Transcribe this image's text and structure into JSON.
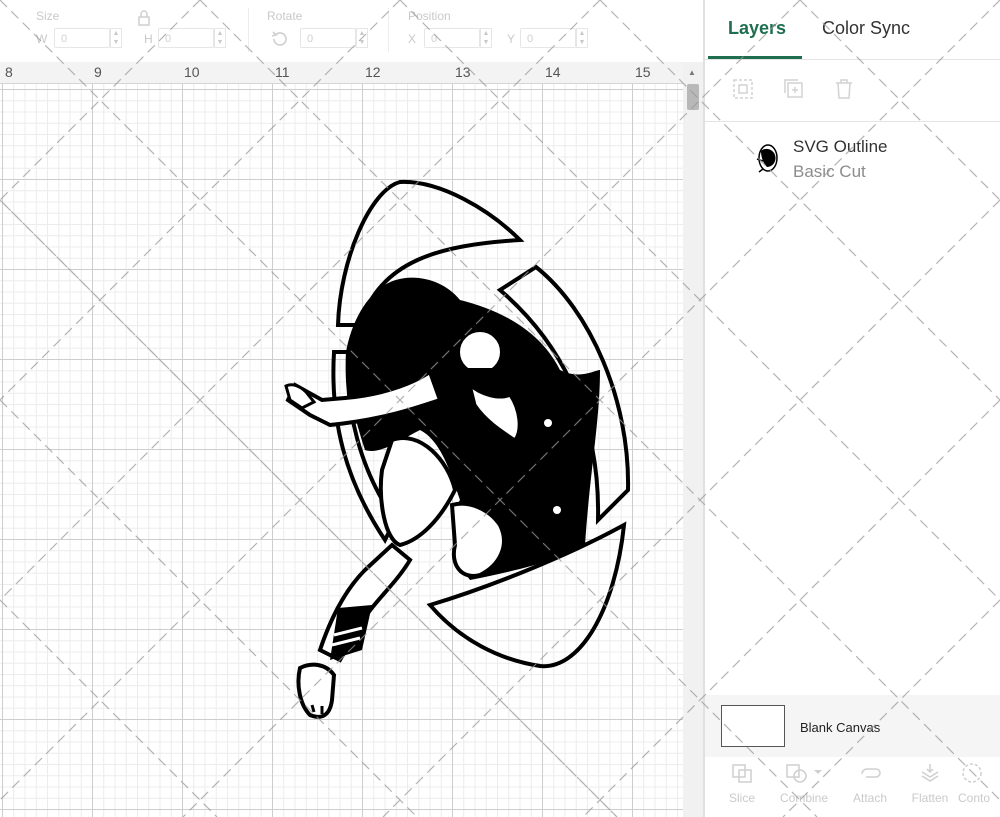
{
  "toolbar": {
    "size_label": "Size",
    "w_label": "W",
    "w_value": "0",
    "h_label": "H",
    "h_value": "0",
    "rotate_label": "Rotate",
    "rotate_value": "0",
    "position_label": "Position",
    "x_label": "X",
    "x_value": "0",
    "y_label": "Y",
    "y_value": "0",
    "lock_icon": "lock-icon",
    "rotate_icon": "rotate-icon"
  },
  "ruler": {
    "numbers": [
      "8",
      "9",
      "10",
      "11",
      "12",
      "13",
      "14",
      "15"
    ]
  },
  "canvas": {
    "image_icon": "football-player-kicker-graphic"
  },
  "panel": {
    "tabs": [
      {
        "label": "Layers",
        "active": true
      },
      {
        "label": "Color Sync",
        "active": false
      }
    ],
    "tools": [
      "group-icon",
      "duplicate-icon",
      "delete-icon"
    ],
    "layer": {
      "name": "SVG Outline",
      "operation": "Basic Cut"
    },
    "blank_canvas_label": "Blank Canvas",
    "bottom_tools": [
      "Slice",
      "Combine",
      "Attach",
      "Flatten",
      "Conto"
    ]
  },
  "colors": {
    "accent": "#1e6e4f",
    "ink": "#000000"
  }
}
